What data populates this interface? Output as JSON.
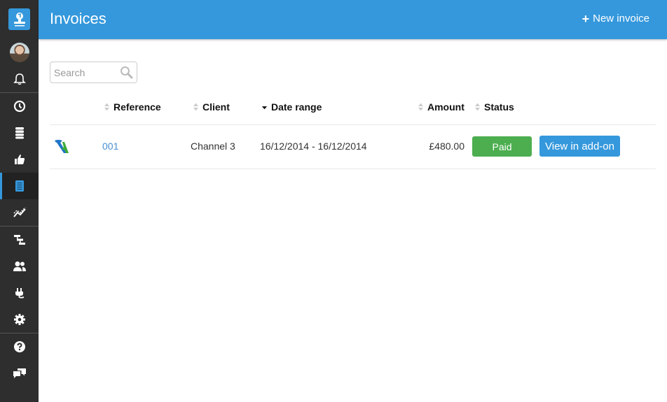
{
  "header": {
    "title": "Invoices",
    "new_invoice_label": "New invoice"
  },
  "sidebar": {
    "items": [
      {
        "name": "notifications",
        "icon": "bell-icon"
      },
      {
        "name": "time",
        "icon": "clock-icon"
      },
      {
        "name": "expenses",
        "icon": "database-icon"
      },
      {
        "name": "approvals",
        "icon": "thumbs-up-icon"
      },
      {
        "name": "invoices",
        "icon": "invoice-icon",
        "active": true
      },
      {
        "name": "reports",
        "icon": "chart-line-icon"
      },
      {
        "name": "projects",
        "icon": "gantt-icon"
      },
      {
        "name": "people",
        "icon": "users-icon"
      },
      {
        "name": "add-ons",
        "icon": "plug-icon"
      },
      {
        "name": "settings",
        "icon": "gear-icon"
      },
      {
        "name": "help",
        "icon": "help-icon"
      },
      {
        "name": "feedback",
        "icon": "chat-icon"
      }
    ]
  },
  "search": {
    "placeholder": "Search",
    "value": ""
  },
  "table": {
    "columns": [
      {
        "label": "Reference",
        "sort": "none"
      },
      {
        "label": "Client",
        "sort": "none"
      },
      {
        "label": "Date range",
        "sort": "desc"
      },
      {
        "label": "Amount",
        "sort": "none"
      },
      {
        "label": "Status",
        "sort": "none"
      }
    ],
    "rows": [
      {
        "source_icon": "addon-logo-icon",
        "reference": "001",
        "client": "Channel 3",
        "date_range": "16/12/2014 - 16/12/2014",
        "amount": "£480.00",
        "status": "Paid",
        "action_label": "View in add-on"
      }
    ]
  },
  "colors": {
    "accent": "#3598dc",
    "sidebar_bg": "#2e2e2e",
    "paid": "#4cae4f",
    "link": "#4a8fd0"
  }
}
